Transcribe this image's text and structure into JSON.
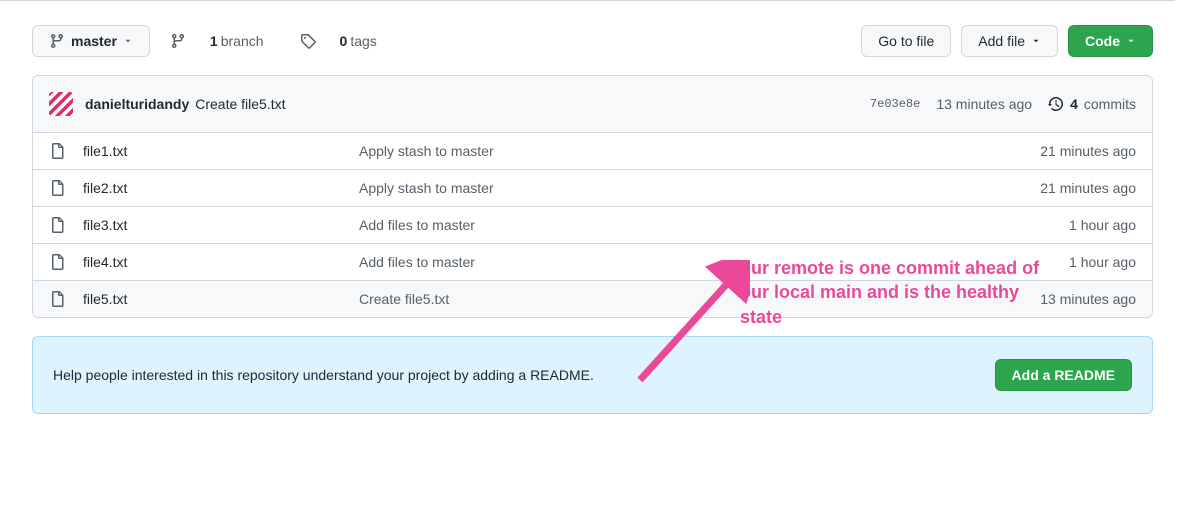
{
  "branchMenu": {
    "label": "master"
  },
  "branchStats": {
    "branchCount": "1",
    "branchLabel": "branch",
    "tagCount": "0",
    "tagLabel": "tags"
  },
  "buttons": {
    "goToFile": "Go to file",
    "addFile": "Add file",
    "code": "Code"
  },
  "latestCommit": {
    "author": "danielturidandy",
    "message": "Create file5.txt",
    "hash": "7e03e8e",
    "time": "13 minutes ago",
    "count": "4",
    "countLabel": "commits"
  },
  "files": [
    {
      "name": "file1.txt",
      "msg": "Apply stash to master",
      "time": "21 minutes ago"
    },
    {
      "name": "file2.txt",
      "msg": "Apply stash to master",
      "time": "21 minutes ago"
    },
    {
      "name": "file3.txt",
      "msg": "Add files to master",
      "time": "1 hour ago"
    },
    {
      "name": "file4.txt",
      "msg": "Add files to master",
      "time": "1 hour ago"
    },
    {
      "name": "file5.txt",
      "msg": "Create file5.txt",
      "time": "13 minutes ago"
    }
  ],
  "readme": {
    "text": "Help people interested in this repository understand your project by adding a README.",
    "button": "Add a README"
  },
  "annotation": {
    "text": "our remote is one commit ahead of our local main and is the healthy state"
  }
}
